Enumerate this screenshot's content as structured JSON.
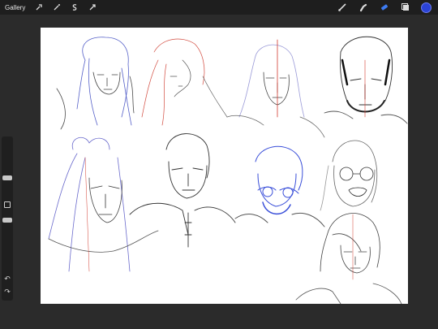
{
  "toolbar": {
    "gallery_label": "Gallery",
    "left_icons": [
      "wrench-icon",
      "magic-wand-icon",
      "selection-s-icon",
      "transform-arrow-icon"
    ],
    "right_icons": [
      "brush-icon",
      "smudge-icon",
      "eraser-icon",
      "layers-icon"
    ],
    "active_color": "#2b43d6"
  },
  "canvas": {
    "background": "#ffffff",
    "stroke_colors": [
      "#4a4a4a",
      "#3a4fd9",
      "#d23a2e",
      "#8a8ad8"
    ]
  },
  "sidebar": {
    "icons": [
      "brush-size-slider",
      "modify-square-icon",
      "opacity-slider",
      "undo-arrow-icon",
      "redo-arrow-icon"
    ]
  }
}
